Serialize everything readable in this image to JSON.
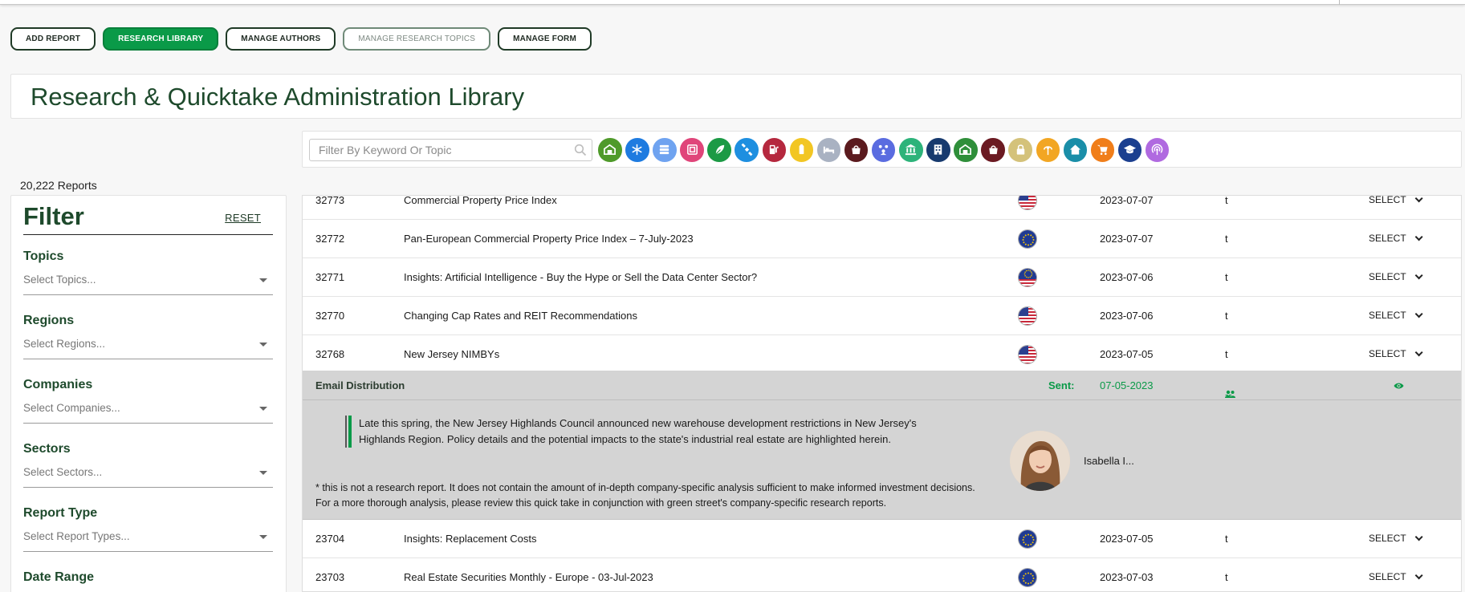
{
  "nav": {
    "buttons": [
      {
        "label": "ADD REPORT",
        "state": "normal"
      },
      {
        "label": "RESEARCH LIBRARY",
        "state": "active"
      },
      {
        "label": "MANAGE AUTHORS",
        "state": "normal"
      },
      {
        "label": "MANAGE RESEARCH TOPICS",
        "state": "disabled"
      },
      {
        "label": "MANAGE FORM",
        "state": "normal"
      }
    ]
  },
  "page_title": "Research & Quicktake Administration Library",
  "search": {
    "placeholder": "Filter By Keyword Or Topic",
    "value": ""
  },
  "topic_icons": [
    {
      "name": "warehouse-icon",
      "color": "#4f9a2a"
    },
    {
      "name": "snowflake-icon",
      "color": "#1e7be0"
    },
    {
      "name": "server-icon",
      "color": "#6fa3f0"
    },
    {
      "name": "storage-units-icon",
      "color": "#e0457a"
    },
    {
      "name": "leaf-icon",
      "color": "#1c9a45"
    },
    {
      "name": "satellite-icon",
      "color": "#1e8fe0"
    },
    {
      "name": "gas-pump-icon",
      "color": "#b5283e"
    },
    {
      "name": "battery-icon",
      "color": "#f2c623"
    },
    {
      "name": "bed-icon",
      "color": "#a9b2c2"
    },
    {
      "name": "shopping-bag-icon",
      "color": "#5b1a1e"
    },
    {
      "name": "community-icon",
      "color": "#5a6ce0"
    },
    {
      "name": "bank-icon",
      "color": "#2db37a"
    },
    {
      "name": "office-building-icon",
      "color": "#173a6e"
    },
    {
      "name": "industrial-icon",
      "color": "#2f8f3a"
    },
    {
      "name": "retail-bag-icon",
      "color": "#6b1a22"
    },
    {
      "name": "lock-icon",
      "color": "#d4c27a"
    },
    {
      "name": "antenna-icon",
      "color": "#f2a623"
    },
    {
      "name": "home-icon",
      "color": "#1a8ea8"
    },
    {
      "name": "cart-icon",
      "color": "#f07e1a"
    },
    {
      "name": "graduation-cap-icon",
      "color": "#1b3f8f"
    },
    {
      "name": "broadcast-icon",
      "color": "#b06ae0"
    }
  ],
  "report_count": "20,222 Reports",
  "filter": {
    "title": "Filter",
    "reset": "RESET",
    "groups": [
      {
        "label": "Topics",
        "placeholder": "Select Topics..."
      },
      {
        "label": "Regions",
        "placeholder": "Select Regions..."
      },
      {
        "label": "Companies",
        "placeholder": "Select Companies..."
      },
      {
        "label": "Sectors",
        "placeholder": "Select Sectors..."
      },
      {
        "label": "Report Type",
        "placeholder": "Select Report Types..."
      },
      {
        "label": "Date Range",
        "placeholder": ""
      }
    ]
  },
  "rows": [
    {
      "id": "32773",
      "title": "Commercial Property Price Index",
      "region": "us",
      "date": "2023-07-07",
      "t": "t",
      "select": "SELECT"
    },
    {
      "id": "32772",
      "title": "Pan-European Commercial Property Price Index – 7-July-2023",
      "region": "eu",
      "date": "2023-07-07",
      "t": "t",
      "select": "SELECT"
    },
    {
      "id": "32771",
      "title": "Insights: Artificial Intelligence - Buy the Hype or Sell the Data Center Sector?",
      "region": "us-eu",
      "date": "2023-07-06",
      "t": "t",
      "select": "SELECT"
    },
    {
      "id": "32770",
      "title": "Changing Cap Rates and REIT Recommendations",
      "region": "us",
      "date": "2023-07-06",
      "t": "t",
      "select": "SELECT"
    },
    {
      "id": "32768",
      "title": "New Jersey NIMBYs",
      "region": "us",
      "date": "2023-07-05",
      "t": "t",
      "select": "SELECT"
    },
    {
      "id": "23704",
      "title": "Insights: Replacement Costs",
      "region": "eu",
      "date": "2023-07-05",
      "t": "t",
      "select": "SELECT"
    },
    {
      "id": "23703",
      "title": "Real Estate Securities Monthly - Europe - 03-Jul-2023",
      "region": "eu",
      "date": "2023-07-03",
      "t": "t",
      "select": "SELECT"
    }
  ],
  "email": {
    "title": "Email Distribution",
    "sent_label": "Sent:",
    "sent_date": "07-05-2023",
    "recipients": "--",
    "summary": "Late this spring, the New Jersey Highlands Council announced new warehouse development restrictions in New Jersey's Highlands Region. Policy details and the potential impacts to the state's industrial real estate are highlighted herein.",
    "author": "Isabella I...",
    "disclaimer": "* this is not a research report. It does not contain the amount of in-depth company-specific analysis sufficient to make informed investment decisions. For a more thorough analysis, please review this quick take in conjunction with green street's company-specific research reports."
  },
  "colors": {
    "accent": "#0a9a48",
    "title": "#1e4a2c",
    "expanded_bg": "#d4d4d4"
  }
}
